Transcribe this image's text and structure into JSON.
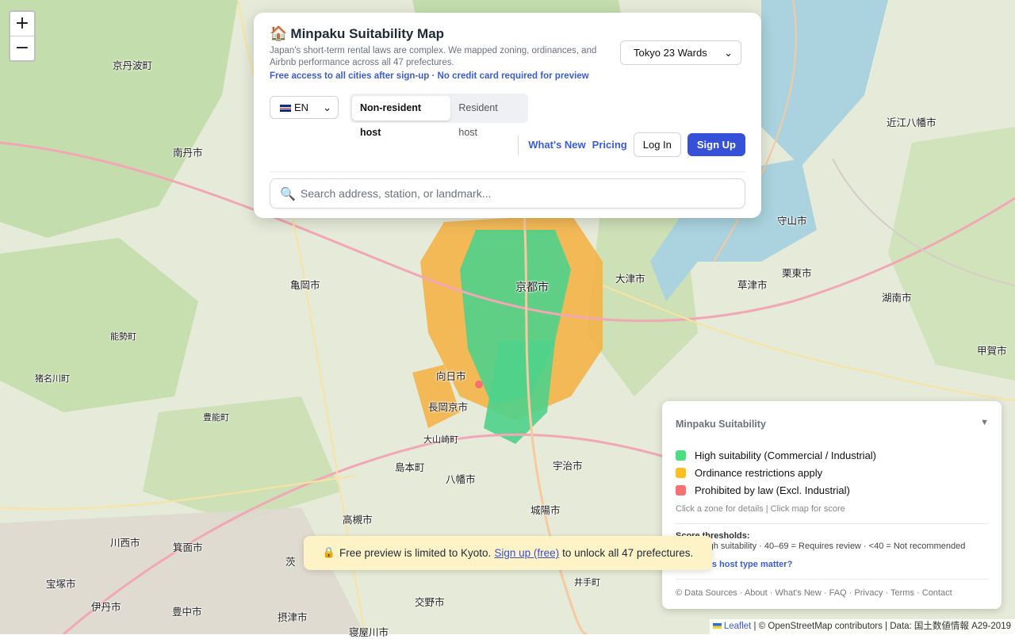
{
  "app": {
    "title": "Minpaku Suitability Map",
    "description": "Japan's short-term rental laws are complex. We mapped zoning, ordinances, and Airbnb performance across all 47 prefectures.",
    "free_access": "Free access to all cities after sign-up · No credit card required for preview"
  },
  "city_select": {
    "value": "Tokyo 23 Wards"
  },
  "language_select": {
    "value": "EN"
  },
  "host_type": {
    "options": [
      "Non-resident host",
      "Resident host"
    ],
    "selected": "Non-resident host"
  },
  "nav": {
    "whats_new": "What's New",
    "pricing": "Pricing",
    "login": "Log In",
    "signup": "Sign Up"
  },
  "search": {
    "placeholder": "Search address, station, or landmark..."
  },
  "map_controls": {
    "zoom_in": "+",
    "zoom_out": "−"
  },
  "legend": {
    "title": "Minpaku Suitability",
    "items": [
      {
        "label": "High suitability (Commercial / Industrial)",
        "color": "#4ade80"
      },
      {
        "label": "Ordinance restrictions apply",
        "color": "#fbbf24"
      },
      {
        "label": "Prohibited by law (Excl. Industrial)",
        "color": "#f87171"
      }
    ],
    "hint": "Click a zone for details | Click map for score",
    "thresholds_title": "Score thresholds:",
    "thresholds_text": "70+ = High suitability · 40–69 = Requires review · <40 = Not recommended",
    "why_link": "Why does host type matter?",
    "footer": "© Data Sources · About · What's New · FAQ · Privacy · Terms · Contact"
  },
  "toast": {
    "before": "Free preview is limited to Kyoto.",
    "link": "Sign up (free)",
    "after": "to unlock all 47 prefectures."
  },
  "attribution": {
    "leaflet": "Leaflet",
    "text": "| © OpenStreetMap contributors | Data: 国土数値情報 A29-2019"
  },
  "map_labels": {
    "minamitan": "南丹市",
    "kyotanba": "京丹波町",
    "kameoka": "亀岡市",
    "nose": "能勢町",
    "inagawa": "猪名川町",
    "toyono": "豊能町",
    "kyoto": "京都市",
    "muko": "向日市",
    "nagaokakyo": "長岡京市",
    "oyamazaki": "大山崎町",
    "shimamoto": "島本町",
    "yawata": "八幡市",
    "uji": "宇治市",
    "joyo": "城陽市",
    "takatsuki": "高槻市",
    "minoh": "箕面市",
    "kawanishi": "川西市",
    "takarazuka": "宝塚市",
    "itami": "伊丹市",
    "toyonaka": "豊中市",
    "settsu": "摂津市",
    "katano": "交野市",
    "neyagawa": "寝屋川市",
    "ibaraki": "茨",
    "otsu": "大津市",
    "kusatsu": "草津市",
    "ritto": "栗東市",
    "moriyama": "守山市",
    "konan": "湖南市",
    "koka": "甲賀市",
    "omihachiman": "近江八幡市",
    "ide": "井手町"
  }
}
